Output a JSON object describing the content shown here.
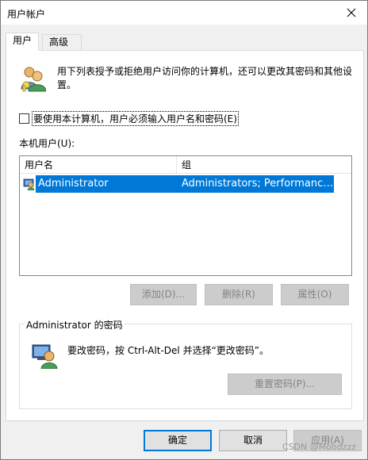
{
  "window": {
    "title": "用户帐户"
  },
  "tabs": [
    {
      "label": "用户"
    },
    {
      "label": "高级"
    }
  ],
  "intro": {
    "text": "用下列表授予或拒绝用户访问你的计算机，还可以更改其密码和其他设置。"
  },
  "require_password": {
    "label": "要使用本计算机，用户必须输入用户名和密码(E)",
    "checked": false
  },
  "users": {
    "label": "本机用户(U):",
    "columns": [
      "用户名",
      "组"
    ],
    "rows": [
      {
        "username": "Administrator",
        "group": "Administrators; Performance L..."
      }
    ]
  },
  "user_buttons": {
    "add": "添加(D)...",
    "remove": "删除(R)",
    "properties": "属性(O)"
  },
  "password_group": {
    "title": "Administrator 的密码",
    "text": "要改密码，按 Ctrl-Alt-Del 并选择“更改密码”。",
    "reset_button": "重置密码(P)..."
  },
  "footer": {
    "ok": "确定",
    "cancel": "取消",
    "apply": "应用(A)"
  },
  "watermark": "CSDN @Moodzzz",
  "icons": {
    "close": "close-icon",
    "users": "users-icon",
    "user": "user-icon",
    "password": "password-icon"
  },
  "colors": {
    "selection": "#0078d7",
    "window": "#f0f0f0"
  }
}
